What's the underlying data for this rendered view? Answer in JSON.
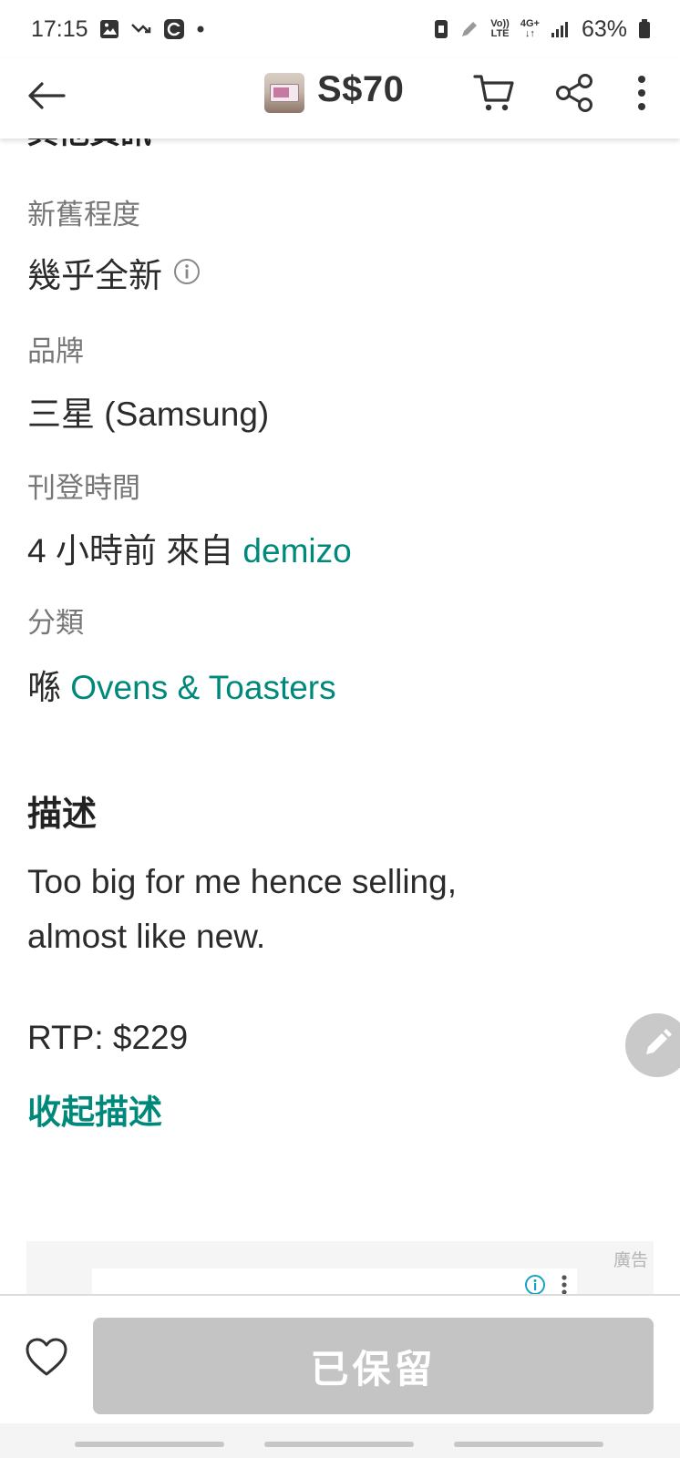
{
  "status_bar": {
    "time": "17:15",
    "network_top": "Vo))",
    "network_bottom": "LTE",
    "gen_top": "4G+",
    "gen_bottom": "↓↑",
    "battery": "63%",
    "icons": [
      "image-icon",
      "missed-call-icon",
      "app-icon",
      "dot-icon",
      "phone-icon",
      "pen-icon",
      "signal-icon",
      "battery-icon"
    ]
  },
  "header": {
    "price": "S$70"
  },
  "details": {
    "partial_heading": "其他資訊",
    "condition_label": "新舊程度",
    "condition_value": "幾乎全新",
    "brand_label": "品牌",
    "brand_value": "三星 (Samsung)",
    "posted_label": "刊登時間",
    "posted_prefix": "4 小時前 來自",
    "seller": "demizo",
    "category_label": "分類",
    "category_prefix": "喺",
    "category": "Ovens & Toasters"
  },
  "description": {
    "title": "描述",
    "line1": "Too big for me hence selling,",
    "line2": "almost like new.",
    "rtp": "RTP: $229",
    "collapse": "收起描述"
  },
  "ad": {
    "label": "廣告"
  },
  "bottom": {
    "button_label": "已保留"
  },
  "colors": {
    "accent": "#00897b",
    "disabled_button": "#c4c4c4",
    "label_gray": "#777777"
  }
}
